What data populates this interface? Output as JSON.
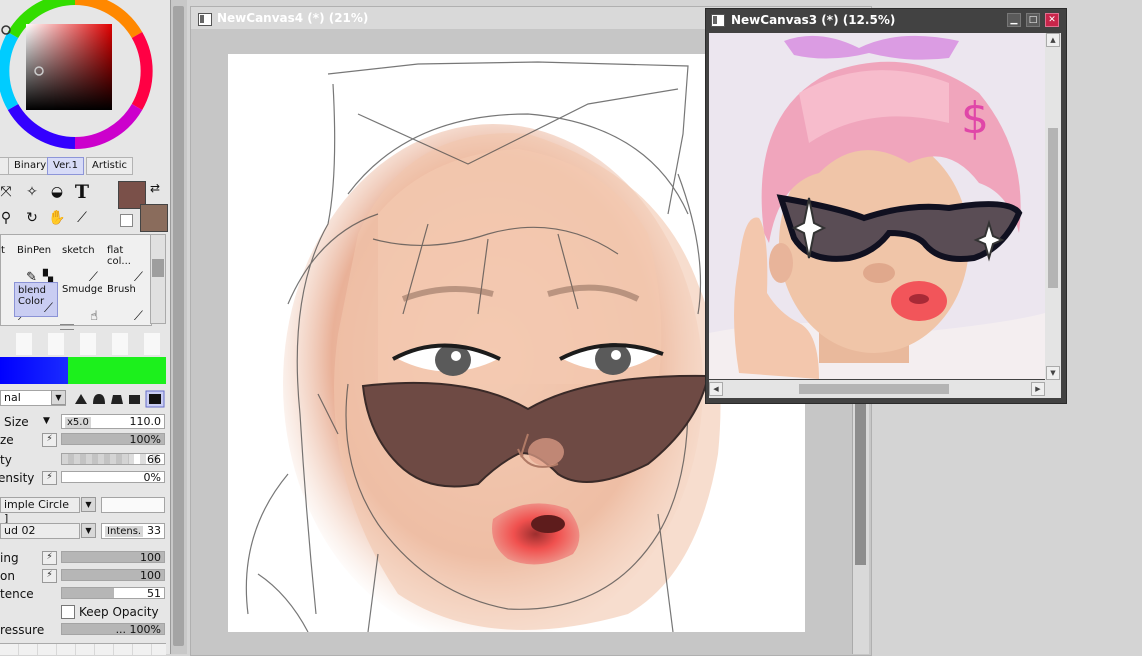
{
  "left_panel": {
    "tabs": [
      "Binary",
      "Ver.1",
      "Artistic"
    ],
    "tools": [
      "selection-icon",
      "magic-wand-icon",
      "fill-icon",
      "text-icon",
      "zoom-icon",
      "rotate-icon",
      "hand-icon",
      "eyedropper-icon"
    ],
    "text_tool_glyph": "T",
    "colors": {
      "primary": "#7a5049",
      "secondary": "#8a6c5c"
    },
    "brushes_row1": [
      {
        "label": "t",
        "icon": "pen-icon"
      },
      {
        "label": "BinPen",
        "icon": "checker-icon"
      },
      {
        "label": "sketch",
        "icon": "brush-icon"
      },
      {
        "label": "flat col...",
        "icon": "brush-icon"
      }
    ],
    "brushes_row2": [
      {
        "label": "",
        "icon": "brush-icon"
      },
      {
        "label": "blend\nColor",
        "icon": "brush-icon",
        "selected": true
      },
      {
        "label": "Smudge",
        "icon": "smudge-icon"
      },
      {
        "label": "Brush",
        "icon": "brush-icon"
      }
    ],
    "blend_mode": "nal",
    "size_label": "Size",
    "size_multiplier": "x5.0",
    "size_value": "110.0",
    "min_size_label": "ze",
    "min_size_value": "100%",
    "density_label": "ty",
    "density_value": "66",
    "min_density_label": "ensity",
    "min_density_value": "0%",
    "shape_value": "imple Circle ]",
    "texture_value": "ud 02",
    "intensity_label": "Intens.",
    "intensity_value": "33",
    "blending_label": "ing",
    "blending_value": "100",
    "dilution_label": "on",
    "dilution_value": "100",
    "persistence_label": "tence",
    "persistence_value": "51",
    "keep_opacity_label": "Keep Opacity",
    "pressure_label": "ressure",
    "pressure_value": "... 100%"
  },
  "canvas_main": {
    "title": "NewCanvas4 (*) (21%)"
  },
  "canvas_float": {
    "title": "NewCanvas3 (*) (12.5%)"
  }
}
